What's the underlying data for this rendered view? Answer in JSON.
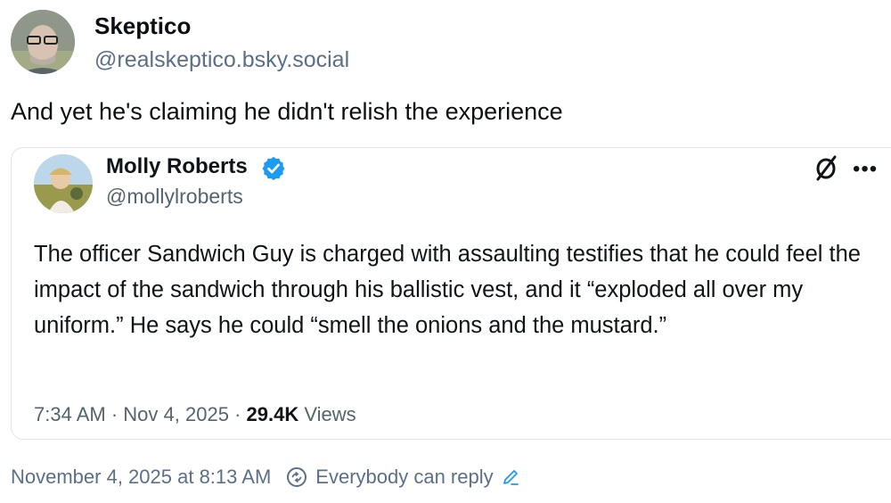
{
  "post": {
    "author_name": "Skeptico",
    "author_handle": "@realskeptico.bsky.social",
    "text": "And yet he's claiming he didn't relish the experience",
    "timestamp": "November 4, 2025 at 8:13 AM",
    "reply_setting": "Everybody can reply"
  },
  "quote": {
    "name": "Molly Roberts",
    "handle": "@mollylroberts",
    "text": "The officer Sandwich Guy is charged with assaulting testifies that he could feel the impact of the sandwich through his ballistic vest, and it “exploded all over my uniform.” He says he could “smell the onions and the mustard.”",
    "time": "7:34 AM",
    "date": "Nov 4, 2025",
    "views_count": "29.4K",
    "views_label": "Views",
    "more_glyph": "•••"
  },
  "colors": {
    "verified": "#1d9bf0",
    "secondary_text": "#536471",
    "footer_text": "#5b6f86"
  },
  "icons": [
    "verified-badge-icon",
    "null-icon",
    "more-icon",
    "reply-settings-icon",
    "pencil-icon"
  ]
}
